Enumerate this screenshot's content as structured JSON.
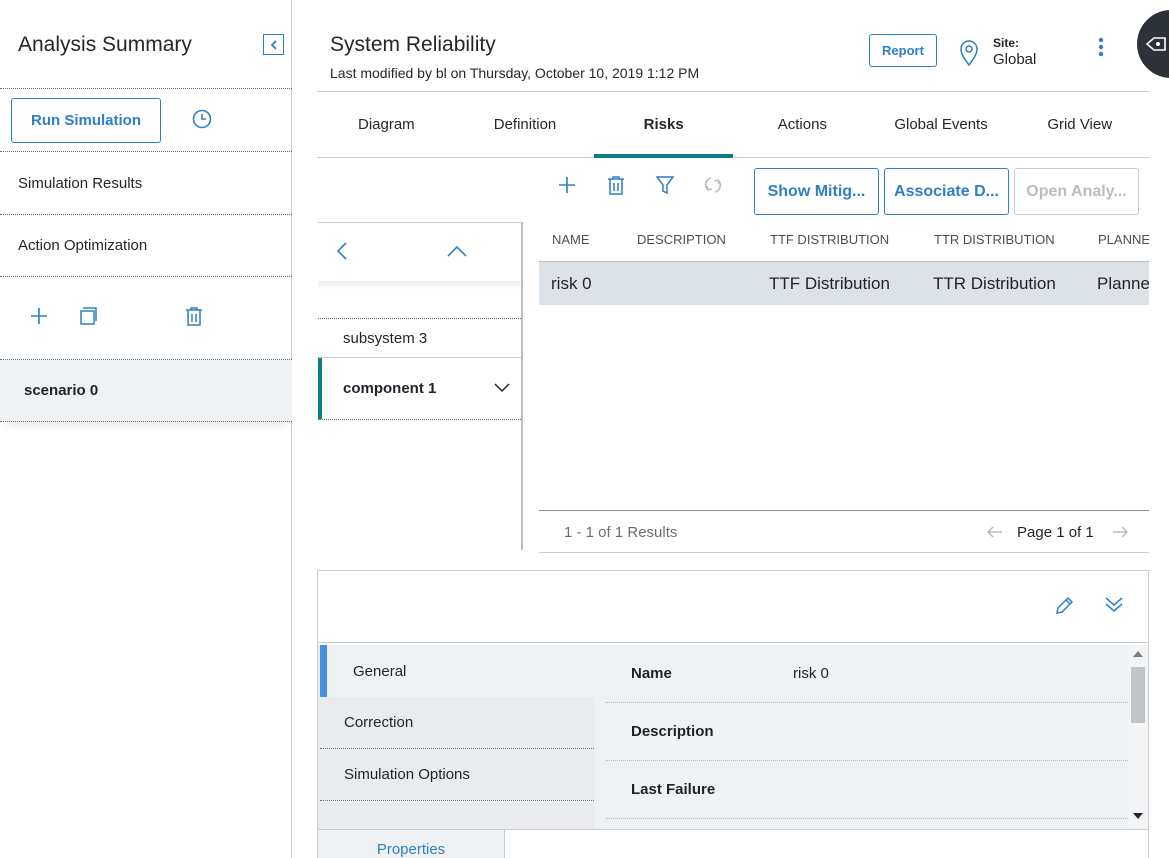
{
  "left_panel": {
    "title": "Analysis Summary",
    "run_simulation_label": "Run Simulation",
    "items": [
      {
        "label": "Simulation Results"
      },
      {
        "label": "Action Optimization"
      }
    ],
    "scenarios": [
      {
        "label": "scenario 0"
      }
    ]
  },
  "header": {
    "title": "System Reliability",
    "modified": "Last modified by bl on Thursday, October 10, 2019 1:12 PM",
    "report_label": "Report",
    "site_label": "Site:",
    "site_value": "Global"
  },
  "tabs": [
    {
      "label": "Diagram"
    },
    {
      "label": "Definition"
    },
    {
      "label": "Risks",
      "active": true
    },
    {
      "label": "Actions"
    },
    {
      "label": "Global Events"
    },
    {
      "label": "Grid View"
    }
  ],
  "toolbar": {
    "show_mitigation": "Show Mitig...",
    "associate": "Associate D...",
    "open_analysis": "Open Analy..."
  },
  "tree": {
    "items": [
      {
        "label": "subsystem 3"
      },
      {
        "label": "component 1",
        "selected": true
      }
    ]
  },
  "grid": {
    "columns": [
      "NAME",
      "DESCRIPTION",
      "TTF DISTRIBUTION",
      "TTR DISTRIBUTION",
      "PLANNE"
    ],
    "rows": [
      {
        "name": "risk 0",
        "description": "",
        "ttf": "TTF Distribution",
        "ttr": "TTR Distribution",
        "planned": "Planne"
      }
    ],
    "results": "1 - 1 of 1 Results",
    "page": "Page 1 of 1"
  },
  "details": {
    "side_tabs": [
      {
        "label": "General",
        "active": true
      },
      {
        "label": "Correction"
      },
      {
        "label": "Simulation Options"
      }
    ],
    "fields": [
      {
        "label": "Name",
        "value": "risk 0"
      },
      {
        "label": "Description",
        "value": ""
      },
      {
        "label": "Last Failure",
        "value": ""
      }
    ],
    "bottom_tab": "Properties"
  },
  "colors": {
    "accent": "#2f7fc4",
    "teal": "#0c7f86",
    "row_selected": "#dde2e7"
  }
}
